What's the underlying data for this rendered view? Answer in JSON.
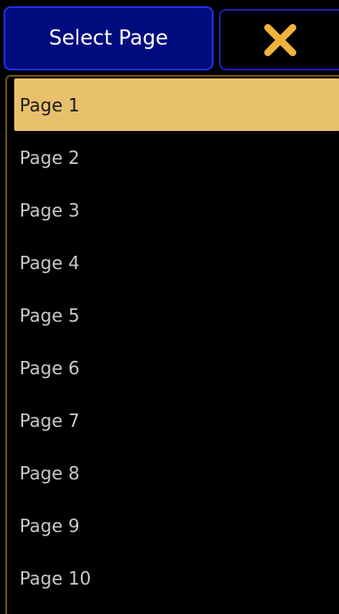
{
  "header": {
    "title": "Select Page",
    "close_icon": "close-x-icon",
    "close_color": "#f0b33c"
  },
  "colors": {
    "title_bg": "#000c7e",
    "selected_bg": "#e8c06c",
    "panel_border": "#6a5414",
    "text": "#c8c8c8"
  },
  "pages": {
    "selected_index": 0,
    "items": [
      {
        "label": "Page 1"
      },
      {
        "label": "Page 2"
      },
      {
        "label": "Page 3"
      },
      {
        "label": "Page 4"
      },
      {
        "label": "Page 5"
      },
      {
        "label": "Page 6"
      },
      {
        "label": "Page 7"
      },
      {
        "label": "Page 8"
      },
      {
        "label": "Page 9"
      },
      {
        "label": "Page 10"
      }
    ]
  }
}
